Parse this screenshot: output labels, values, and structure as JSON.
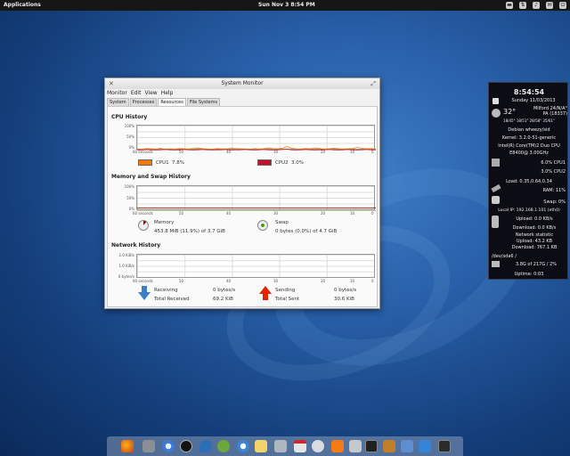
{
  "topbar": {
    "applications": "Applications",
    "datetime": "Sun Nov  3  8:54 PM",
    "tray_icons": [
      "folder-icon",
      "network-icon",
      "volume-icon",
      "mail-icon",
      "power-icon"
    ]
  },
  "window": {
    "title": "System Monitor",
    "menu": [
      "Monitor",
      "Edit",
      "View",
      "Help"
    ],
    "tabs": [
      "System",
      "Processes",
      "Resources",
      "File Systems"
    ],
    "active_tab": "Resources"
  },
  "cpu": {
    "heading": "CPU History",
    "yticks": [
      "100%",
      "50%",
      "0%"
    ],
    "xticks": [
      "60 seconds",
      "50",
      "40",
      "30",
      "20",
      "10",
      "0"
    ],
    "cpu1_label": "CPU1",
    "cpu1_value": "7.8%",
    "cpu1_color": "#f57900",
    "cpu2_label": "CPU2",
    "cpu2_value": "3.0%",
    "cpu2_color": "#c4112a",
    "cpu1_series": [
      6,
      5,
      8,
      7,
      6,
      9,
      5,
      7,
      6,
      8,
      7,
      6,
      9,
      10,
      7,
      6,
      5,
      8,
      7,
      6,
      9,
      8,
      7,
      6,
      5,
      8,
      6,
      7,
      10,
      8,
      7,
      9,
      16,
      9,
      7,
      6,
      8,
      7,
      10,
      8,
      6,
      7,
      9,
      8,
      6,
      7,
      8,
      12,
      9,
      7,
      8,
      6
    ],
    "cpu2_series": [
      3,
      2,
      4,
      3,
      2,
      3,
      4,
      3,
      2,
      3,
      4,
      3,
      2,
      3,
      4,
      3,
      2,
      3,
      3,
      4,
      2,
      3,
      3,
      4,
      3,
      2,
      3,
      4,
      3,
      2,
      3,
      4,
      5,
      3,
      2,
      3,
      4,
      3,
      2,
      3,
      3,
      4,
      3,
      2,
      3,
      4,
      3,
      2,
      3,
      4,
      3,
      3
    ]
  },
  "memory": {
    "heading": "Memory and Swap History",
    "yticks": [
      "100%",
      "50%",
      "0%"
    ],
    "xticks": [
      "60 seconds",
      "50",
      "40",
      "30",
      "20",
      "10",
      "0"
    ],
    "mem_label": "Memory",
    "mem_value": "453.8 MiB (11.9%) of 3.7 GiB",
    "mem_color": "#a40000",
    "mem_percent": 11.9,
    "swap_label": "Swap",
    "swap_value": "0 bytes (0.0%) of 4.7 GiB",
    "swap_color": "#4e9a06",
    "swap_percent": 0
  },
  "network": {
    "heading": "Network History",
    "yticks": [
      "2.0 KiB/s",
      "1.0 KiB/s",
      "0 bytes/s"
    ],
    "xticks": [
      "60 seconds",
      "50",
      "40",
      "30",
      "20",
      "10",
      "0"
    ],
    "recv_label": "Receiving",
    "recv_value": "0 bytes/s",
    "total_recv_label": "Total Received",
    "total_recv_value": "69.2 KiB",
    "send_label": "Sending",
    "send_value": "0 bytes/s",
    "total_sent_label": "Total Sent",
    "total_sent_value": "30.6 KiB"
  },
  "conky": {
    "time": "8:54:54",
    "date": "Sunday 11/03/2013",
    "temp": "32°",
    "location": "Milford 24/N/A°",
    "state": "PA (18337)",
    "forecast": "18/45° 18/51° 28/58° 35/61°",
    "distro": "Debian wheezy/sid",
    "kernel": "Kernel: 3.2.0-51-generic",
    "cpu_model": "Intel(R) Core(TM)2 Duo CPU",
    "cpu_freq": "E8400@ 3.00GHz",
    "cpu1": "6.0% CPU1",
    "cpu2": "3.0% CPU2",
    "load": "Load: 0.35,0.64,0.34",
    "ram": "RAM: 11%",
    "swap": "Swap: 0%",
    "local_ip": "Local IP: 192.168.1.101 (eth0)",
    "upload": "Upload: 0.0 KB/s",
    "download": "Download: 0.0 KB/s",
    "net_stat": "Network statistic",
    "upload_total": "Upload: 43.2 KB",
    "download_total": "Download: 767.1 KB",
    "disk": "/dev/sda6   /",
    "disk_usage": "3.8G of 217G / 2%",
    "uptime": "Uptime: 0:03"
  },
  "dock": [
    "firefox-icon",
    "files-icon",
    "chromium-icon",
    "audacious-icon",
    "transmission-icon",
    "geany-icon",
    "gedit-icon",
    "camera-icon",
    "calendar-icon",
    "clock-icon",
    "vlc-icon",
    "terminal-icon",
    "file-manager-icon",
    "synaptic-icon",
    "download-icon",
    "system-monitor-icon"
  ]
}
